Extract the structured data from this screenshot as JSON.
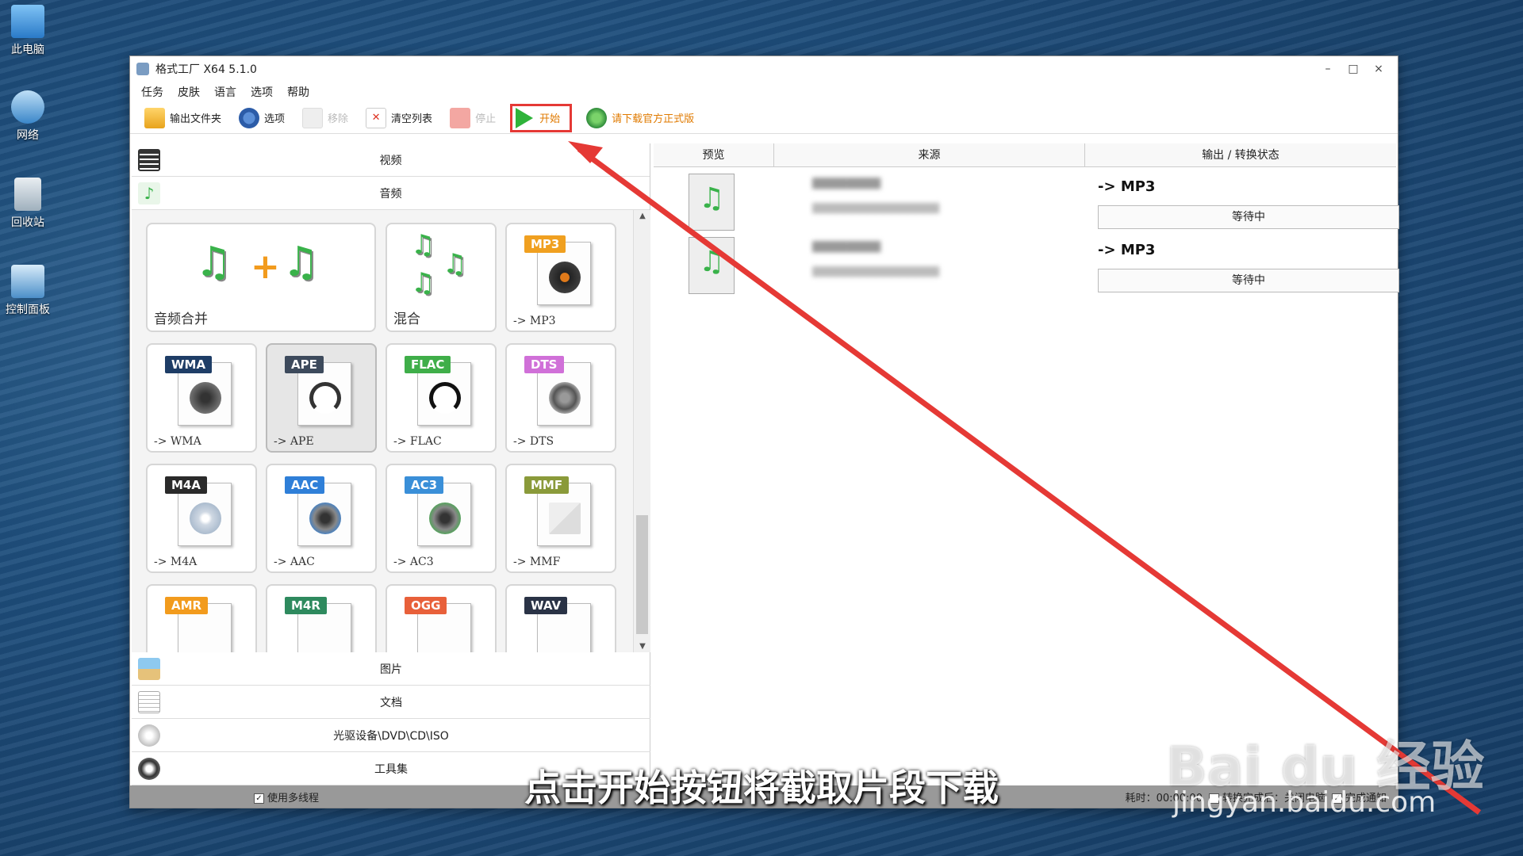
{
  "desktop": {
    "icons": [
      {
        "label": "此电脑",
        "icon": "computer-icon"
      },
      {
        "label": "网络",
        "icon": "network-icon"
      },
      {
        "label": "回收站",
        "icon": "recycle-bin-icon"
      },
      {
        "label": "控制面板",
        "icon": "control-panel-icon"
      }
    ]
  },
  "window": {
    "title": "格式工厂 X64 5.1.0",
    "controls": [
      "–",
      "□",
      "×"
    ]
  },
  "menu": [
    "任务",
    "皮肤",
    "语言",
    "选项",
    "帮助"
  ],
  "toolbar": {
    "output_folder": "输出文件夹",
    "options": "选项",
    "remove": "移除",
    "clear_list": "清空列表",
    "stop": "停止",
    "start": "开始",
    "download": "请下载官方正式版"
  },
  "categories_top": [
    "视频",
    "音频"
  ],
  "categories_bottom": [
    "图片",
    "文档",
    "光驱设备\\DVD\\CD\\ISO",
    "工具集"
  ],
  "tiles": [
    {
      "label": "音频合并",
      "badge": ""
    },
    {
      "label": "混合",
      "badge": ""
    },
    {
      "label": "-> MP3",
      "badge": "MP3",
      "color": "#f0a020"
    },
    {
      "label": "-> WMA",
      "badge": "WMA",
      "color": "#1e3d66"
    },
    {
      "label": "-> APE",
      "badge": "APE",
      "color": "#3d4a5c"
    },
    {
      "label": "-> FLAC",
      "badge": "FLAC",
      "color": "#3fae49"
    },
    {
      "label": "-> DTS",
      "badge": "DTS",
      "color": "#d070d8"
    },
    {
      "label": "-> M4A",
      "badge": "M4A",
      "color": "#2a2a2a"
    },
    {
      "label": "-> AAC",
      "badge": "AAC",
      "color": "#2f7fd8"
    },
    {
      "label": "-> AC3",
      "badge": "AC3",
      "color": "#3a8fd8"
    },
    {
      "label": "-> MMF",
      "badge": "MMF",
      "color": "#8a9a3a"
    },
    {
      "label": "",
      "badge": "AMR",
      "color": "#f29b1d"
    },
    {
      "label": "",
      "badge": "M4R",
      "color": "#2e8a5e"
    },
    {
      "label": "",
      "badge": "OGG",
      "color": "#e8603a"
    },
    {
      "label": "",
      "badge": "WAV",
      "color": "#2a3346"
    }
  ],
  "table": {
    "headers": [
      "预览",
      "来源",
      "输出 / 转换状态"
    ],
    "rows": [
      {
        "output": "-> MP3",
        "status": "等待中"
      },
      {
        "output": "-> MP3",
        "status": "等待中"
      }
    ]
  },
  "statusbar": {
    "multithread": "使用多线程",
    "elapsed": "耗时：00:00:00",
    "after_done": "转换完成后：关闭电脑",
    "notify": "完成通知"
  },
  "caption": "点击开始按钮将截取片段下载",
  "watermark": {
    "brand": "Bai du 经验",
    "url": "jingyan.baidu.com"
  }
}
